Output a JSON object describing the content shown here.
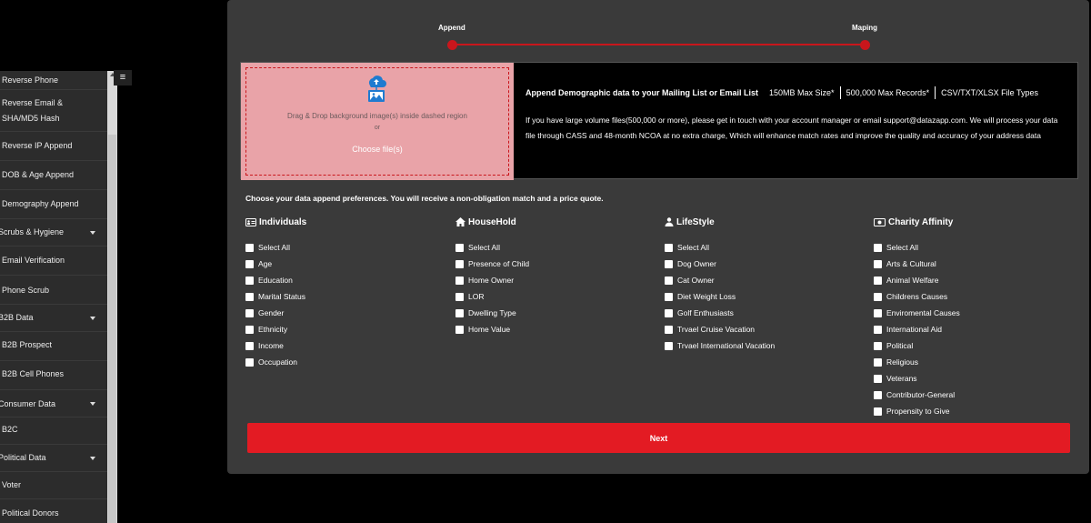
{
  "sidebar": {
    "items": [
      {
        "label": "Reverse Phone"
      },
      {
        "label": "Reverse Email &\nSHA/MD5 Hash"
      },
      {
        "label": "Reverse IP Append"
      },
      {
        "label": "DOB & Age Append"
      },
      {
        "label": "Demography Append"
      },
      {
        "label": "Scrubs & Hygiene"
      },
      {
        "label": "Email Verification"
      },
      {
        "label": "Phone Scrub"
      },
      {
        "label": "B2B Data"
      },
      {
        "label": "B2B Prospect"
      },
      {
        "label": "B2B Cell Phones"
      },
      {
        "label": "Consumer Data"
      },
      {
        "label": "B2C"
      },
      {
        "label": "Political Data"
      },
      {
        "label": "Voter"
      },
      {
        "label": "Political Donors"
      }
    ],
    "menu_icon": "hamburger-icon"
  },
  "steps": {
    "first": "Append",
    "second": "Maping"
  },
  "upload": {
    "drag_text": "Drag & Drop background image(s) inside dashed region",
    "or_text": "or",
    "choose_label": "Choose file(s)"
  },
  "info": {
    "title": "Append Demographic data to your Mailing List or Email List",
    "max_size": "150MB Max Size*",
    "max_records": "500,000 Max Records*",
    "file_types": "CSV/TXT/XLSX File Types",
    "body": "If you have large volume files(500,000 or more), please get in touch with your account manager or email support@datazapp.com. We will process your data file through CASS and 48-month NCOA at no extra charge, Which will enhance match rates and improve the quality and accuracy of your address data"
  },
  "prefs_label": "Choose your data append preferences. You will receive a non-obligation match and a price quote.",
  "columns": [
    {
      "title": "Individuals",
      "icon": "id-card-icon",
      "options": [
        "Select All",
        "Age",
        "Education",
        "Marital Status",
        "Gender",
        "Ethnicity",
        "Income",
        "Occupation"
      ]
    },
    {
      "title": "HouseHold",
      "icon": "home-icon",
      "options": [
        "Select All",
        "Presence of Child",
        "Home Owner",
        "LOR",
        "Dwelling Type",
        "Home Value"
      ]
    },
    {
      "title": "LifeStyle",
      "icon": "users-icon",
      "options": [
        "Select All",
        "Dog Owner",
        "Cat Owner",
        "Diet Weight Loss",
        "Golf Enthusiasts",
        "Trvael Cruise Vacation",
        "Trvael International Vacation"
      ]
    },
    {
      "title": "Charity Affinity",
      "icon": "money-icon",
      "options": [
        "Select All",
        "Arts & Cultural",
        "Animal Welfare",
        "Childrens Causes",
        "Enviromental Causes",
        "International Aid",
        "Political",
        "Religious",
        "Veterans",
        "Contributor-General",
        "Propensity to Give"
      ]
    }
  ],
  "next_label": "Next",
  "colors": {
    "accent": "#e31b23",
    "panel": "#3a3a3a",
    "dropzone": "#e9a3a8"
  }
}
